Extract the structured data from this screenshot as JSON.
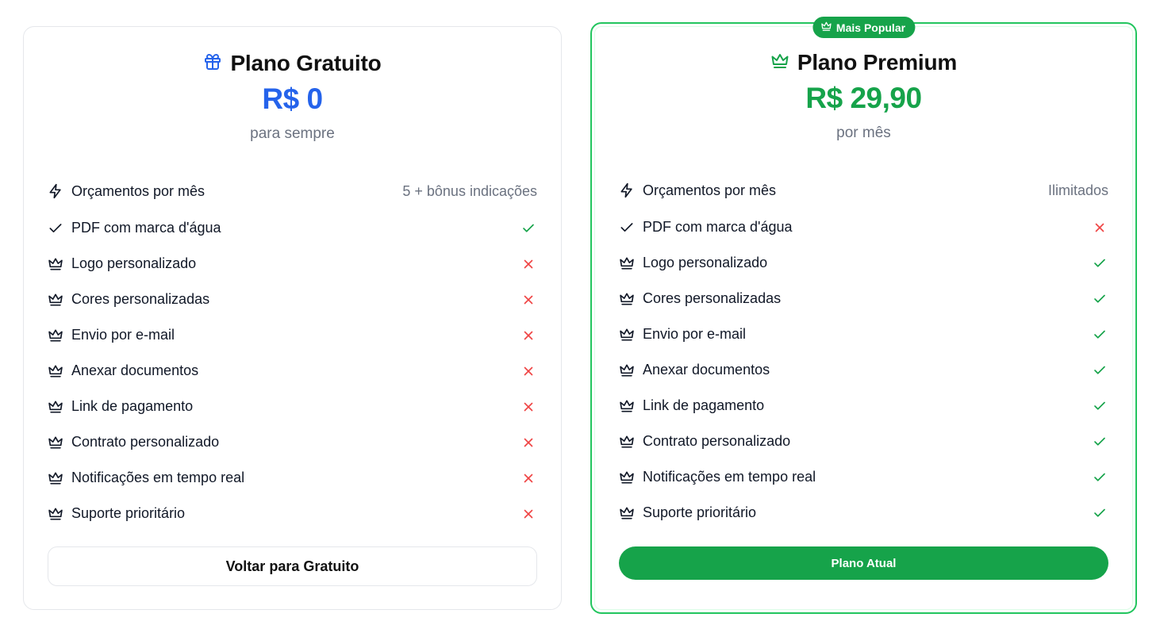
{
  "free_plan": {
    "title": "Plano Gratuito",
    "icon": "gift-icon",
    "price": "R$ 0",
    "period": "para sempre",
    "button_label": "Voltar para Gratuito",
    "accent_color": "#2563eb",
    "features": [
      {
        "label": "Orçamentos por mês",
        "icon": "lightning-icon",
        "value": "5 + bônus indicações"
      },
      {
        "label": "PDF com marca d'água",
        "icon": "check-icon",
        "included": true
      },
      {
        "label": "Logo personalizado",
        "icon": "crown-icon",
        "included": false
      },
      {
        "label": "Cores personalizadas",
        "icon": "crown-icon",
        "included": false
      },
      {
        "label": "Envio por e-mail",
        "icon": "crown-icon",
        "included": false
      },
      {
        "label": "Anexar documentos",
        "icon": "crown-icon",
        "included": false
      },
      {
        "label": "Link de pagamento",
        "icon": "crown-icon",
        "included": false
      },
      {
        "label": "Contrato personalizado",
        "icon": "crown-icon",
        "included": false
      },
      {
        "label": "Notificações em tempo real",
        "icon": "crown-icon",
        "included": false
      },
      {
        "label": "Suporte prioritário",
        "icon": "crown-icon",
        "included": false
      }
    ]
  },
  "premium_plan": {
    "badge": "Mais Popular",
    "title": "Plano Premium",
    "icon": "crown-icon",
    "price": "R$ 29,90",
    "period": "por mês",
    "button_label": "Plano Atual",
    "accent_color": "#16a34a",
    "features": [
      {
        "label": "Orçamentos por mês",
        "icon": "lightning-icon",
        "value": "Ilimitados"
      },
      {
        "label": "PDF com marca d'água",
        "icon": "check-icon",
        "included": false
      },
      {
        "label": "Logo personalizado",
        "icon": "crown-icon",
        "included": true
      },
      {
        "label": "Cores personalizadas",
        "icon": "crown-icon",
        "included": true
      },
      {
        "label": "Envio por e-mail",
        "icon": "crown-icon",
        "included": true
      },
      {
        "label": "Anexar documentos",
        "icon": "crown-icon",
        "included": true
      },
      {
        "label": "Link de pagamento",
        "icon": "crown-icon",
        "included": true
      },
      {
        "label": "Contrato personalizado",
        "icon": "crown-icon",
        "included": true
      },
      {
        "label": "Notificações em tempo real",
        "icon": "crown-icon",
        "included": true
      },
      {
        "label": "Suporte prioritário",
        "icon": "crown-icon",
        "included": true
      }
    ]
  },
  "colors": {
    "included": "#16a34a",
    "excluded": "#ef4444",
    "border_premium": "#22c55e",
    "muted_text": "#6b7280"
  }
}
